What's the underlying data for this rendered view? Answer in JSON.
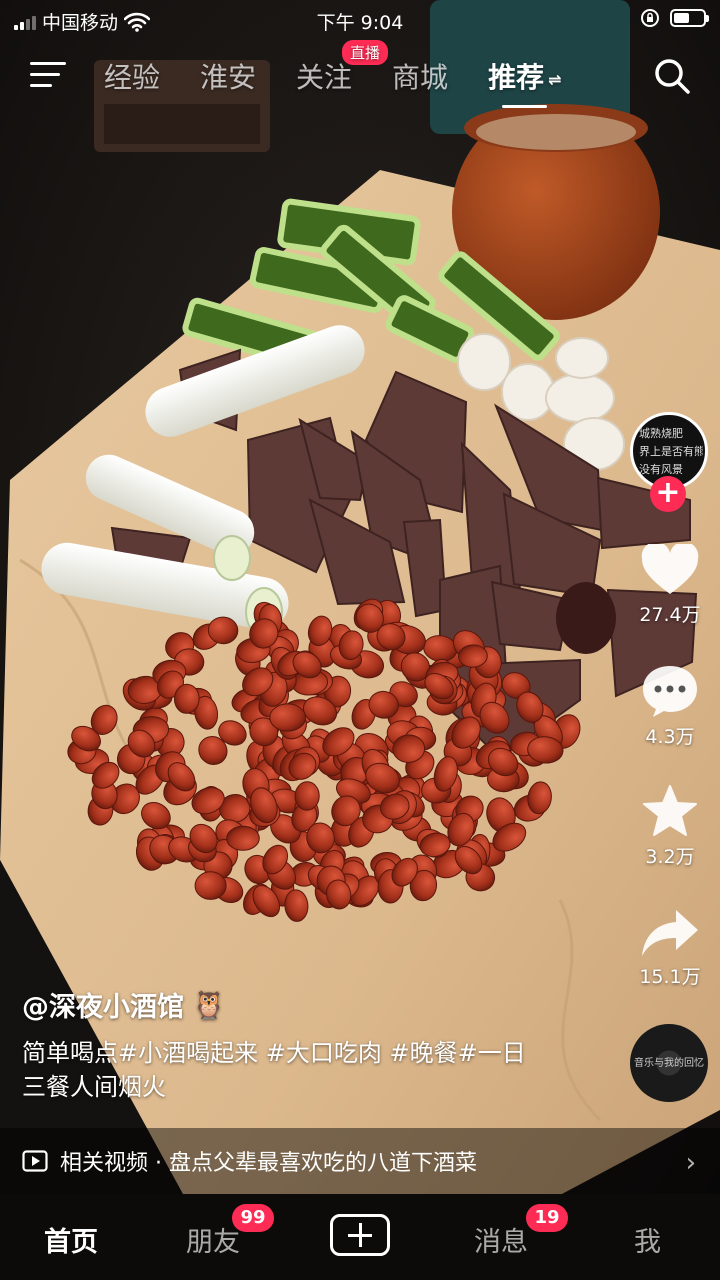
{
  "status_bar": {
    "carrier": "中国移动",
    "time": "下午 9:04",
    "battery_level": 0.55
  },
  "top_nav": {
    "tabs": [
      {
        "label": "经验"
      },
      {
        "label": "淮安"
      },
      {
        "label": "关注",
        "badge": "直播"
      },
      {
        "label": "商城"
      },
      {
        "label": "推荐",
        "active": true
      }
    ],
    "icons": [
      "menu-icon",
      "search-icon"
    ]
  },
  "video": {
    "author": "@深夜小酒馆",
    "author_emoji": "🦉",
    "description": "简单喝点#小酒喝起来 #大口吃肉 #晚餐#一日三餐人间烟火",
    "avatar_text": [
      "城熟烧肥",
      "界上是否有熊猫",
      "没有风景"
    ],
    "music_disc_text": "音乐与我的回忆",
    "likes": "27.4万",
    "comments": "4.3万",
    "favorites": "3.2万",
    "shares": "15.1万"
  },
  "related": {
    "label": "相关视频 · 盘点父辈最喜欢吃的八道下酒菜"
  },
  "bottom_nav": {
    "items": [
      {
        "label": "首页",
        "active": true
      },
      {
        "label": "朋友",
        "badge": "99"
      },
      {
        "label": "消息",
        "badge": "19"
      },
      {
        "label": "我"
      }
    ]
  },
  "colors": {
    "accent": "#fe2c55",
    "paper": "#e2c097",
    "peanut": "#b0321c",
    "liver": "#5e3a37",
    "cucumber": "#8ab84a"
  }
}
